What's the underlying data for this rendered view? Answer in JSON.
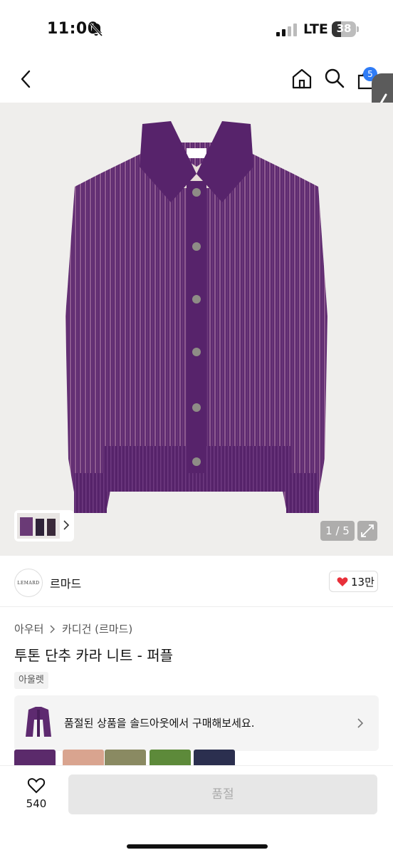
{
  "status": {
    "time": "11:00",
    "network": "LTE",
    "battery": "38",
    "battery_level": 0.38
  },
  "nav": {
    "cart_count": "5",
    "icons": [
      "back-icon",
      "home-icon",
      "search-icon",
      "cart-icon"
    ]
  },
  "gallery": {
    "counter": "1 / 5",
    "current": 1,
    "total": 5
  },
  "brand": {
    "logo_text": "LEMARD",
    "name": "르마드",
    "likes": "13만"
  },
  "product": {
    "breadcrumb": [
      "아우터",
      "카디건 (르마드)"
    ],
    "title": "투톤 단추 카라 니트 - 퍼플",
    "tag": "아울렛"
  },
  "soldout_banner": {
    "text": "품절된 상품을 솔드아웃에서 구매해보세요."
  },
  "swatch_colors": [
    "#5b2a6b",
    "#d9a48f",
    "#8a8a62",
    "#5d8a3a",
    "#2b2f4f"
  ],
  "bottom_bar": {
    "wish_count": "540",
    "button_label": "품절"
  },
  "colors": {
    "accent_badge": "#2f7cf6",
    "heart": "#e8303a",
    "garment_purple": "#5b2a6b"
  }
}
